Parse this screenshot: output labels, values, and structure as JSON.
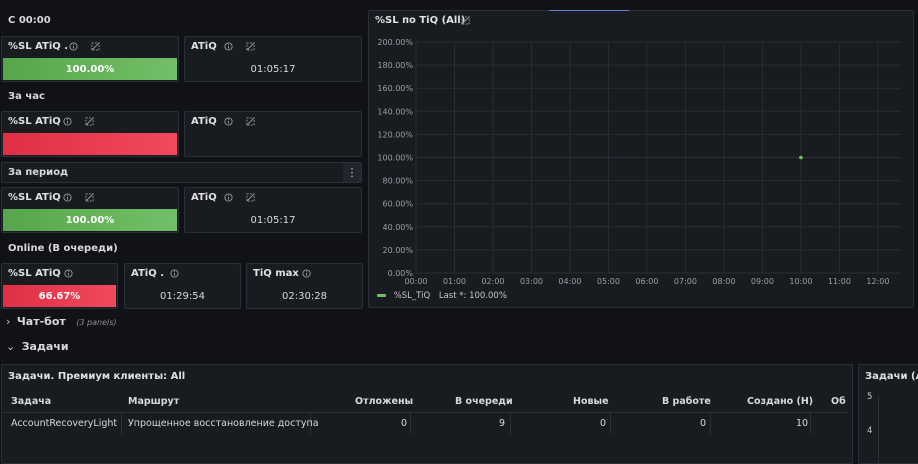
{
  "sections": {
    "since_midnight": "С 00:00",
    "per_hour": "За час",
    "per_period": "За период",
    "online": "Online (В очереди)"
  },
  "panels": {
    "sl1": {
      "title": "%SL ATiQ .",
      "value": "100.00%"
    },
    "atiq1": {
      "title": "ATiQ",
      "value": "01:05:17"
    },
    "sl2": {
      "title": "%SL ATiQ",
      "value": ""
    },
    "atiq2": {
      "title": "ATiQ",
      "value": ""
    },
    "sl3": {
      "title": "%SL ATiQ",
      "value": "100.00%"
    },
    "atiq3": {
      "title": "ATiQ",
      "value": "01:05:17"
    },
    "sl4": {
      "title": "%SL ATiQ",
      "value": "66.67%"
    },
    "atiq4": {
      "title": "ATiQ .",
      "value": "01:29:54"
    },
    "tiqmax": {
      "title": "TiQ max",
      "value": "02:30:28"
    }
  },
  "menu_dots": "⋮",
  "chart": {
    "title": "%SL по TiQ (All)",
    "legend_label": "%SL_TiQ",
    "legend_last": "Last *: 100.00%"
  },
  "chart_data": {
    "type": "scatter",
    "title": "%SL по TiQ (All)",
    "xlabel": "",
    "ylabel": "",
    "x_ticks": [
      "00:00",
      "01:00",
      "02:00",
      "03:00",
      "04:00",
      "05:00",
      "06:00",
      "07:00",
      "08:00",
      "09:00",
      "10:00",
      "11:00",
      "12:00"
    ],
    "y_ticks": [
      "0.00%",
      "20.00%",
      "40.00%",
      "60.00%",
      "80.00%",
      "100.00%",
      "120.00%",
      "140.00%",
      "160.00%",
      "180.00%",
      "200.00%"
    ],
    "ylim": [
      0,
      200
    ],
    "xlim_hours": [
      0,
      12.6
    ],
    "grid": true,
    "legend_position": "bottom-left",
    "series": [
      {
        "name": "%SL_TiQ",
        "color": "#73bf69",
        "x": [
          "10:00"
        ],
        "y": [
          100
        ]
      }
    ]
  },
  "rows": {
    "chatbot": {
      "chevron": "›",
      "title": "Чат-бот",
      "count": "(3 panels)"
    },
    "tasks": {
      "chevron": "⌄",
      "title": "Задачи"
    }
  },
  "table": {
    "title": "Задачи. Премиум клиенты: All",
    "headers": [
      "Задача",
      "Маршрут",
      "Отложены",
      "В очереди",
      "Новые",
      "В работе",
      "Создано (Н)",
      "Обр"
    ],
    "rows": [
      [
        "AccountRecoveryLight",
        "Упрощенное восстановление доступа",
        "0",
        "9",
        "0",
        "0",
        "10",
        ""
      ]
    ]
  },
  "right_panel": {
    "title": "Задачи (All)",
    "y_ticks": [
      "5",
      "4"
    ]
  },
  "colors": {
    "background": "#111217",
    "panel": "#181b1f",
    "green": "#73bf69",
    "red": "#f2495c"
  }
}
